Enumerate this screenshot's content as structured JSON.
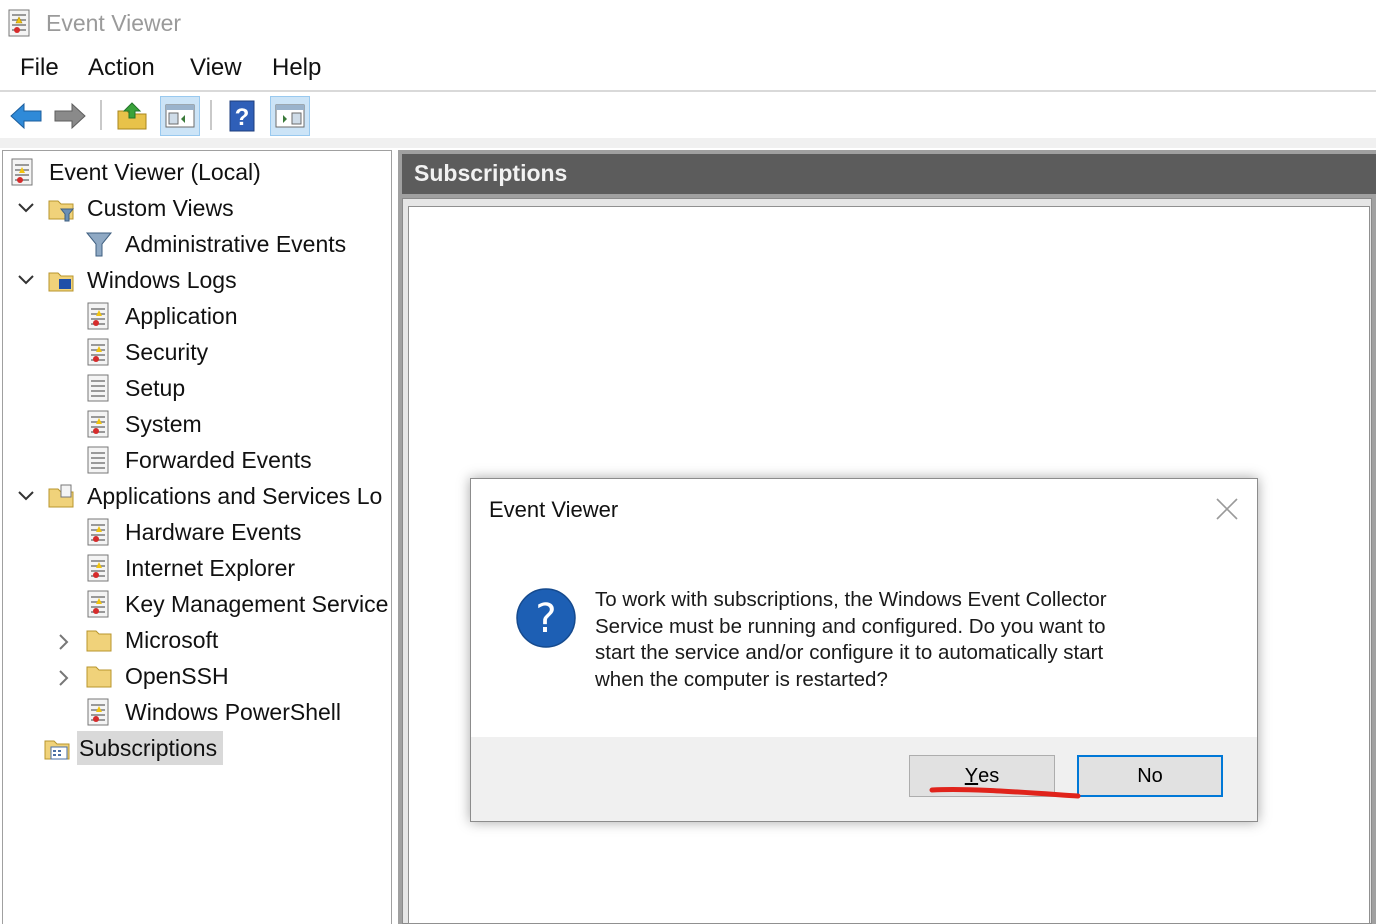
{
  "window": {
    "title": "Event Viewer"
  },
  "menu": [
    "File",
    "Action",
    "View",
    "Help"
  ],
  "toolbar": {
    "buttons": [
      "back-icon",
      "forward-icon",
      "up-folder-icon",
      "show-hide-console-tree-icon",
      "help-icon",
      "show-hide-action-pane-icon"
    ]
  },
  "tree": {
    "root": "Event Viewer (Local)",
    "custom_views": "Custom Views",
    "administrative_events": "Administrative Events",
    "windows_logs": "Windows Logs",
    "application": "Application",
    "security": "Security",
    "setup": "Setup",
    "system": "System",
    "forwarded_events": "Forwarded Events",
    "apps_services": "Applications and Services Lo",
    "hardware_events": "Hardware Events",
    "internet_explorer": "Internet Explorer",
    "key_management": "Key Management Service",
    "microsoft": "Microsoft",
    "openssh": "OpenSSH",
    "powershell": "Windows PowerShell",
    "subscriptions": "Subscriptions"
  },
  "pane": {
    "header": "Subscriptions"
  },
  "dialog": {
    "title": "Event Viewer",
    "message_lines": [
      "To work with subscriptions, the Windows Event Collector",
      "Service must be running and configured.  Do you want to",
      "start the service and/or configure it to automatically start",
      "when the computer is restarted?"
    ],
    "yes_label_accel": "Y",
    "yes_label_rest": "es",
    "no_label": "No"
  },
  "colors": {
    "header_bg": "#5c5c5c",
    "focus_blue": "#0078d7",
    "annotation_red": "#e0231b",
    "question_blue": "#1d5fb4"
  }
}
